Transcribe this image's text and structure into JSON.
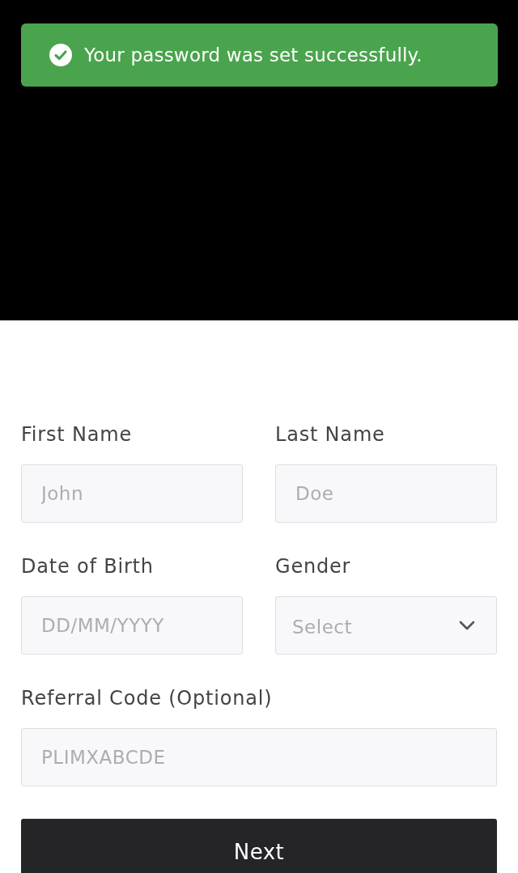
{
  "toast": {
    "message": "Your password was set successfully."
  },
  "form": {
    "rows": [
      {
        "fields": [
          {
            "label": "First Name",
            "kind": "text",
            "placeholder": "John"
          },
          {
            "label": "Last Name",
            "kind": "text",
            "placeholder": "Doe"
          }
        ]
      },
      {
        "fields": [
          {
            "label": "Date of Birth",
            "kind": "text",
            "placeholder": "DD/MM/YYYY"
          },
          {
            "label": "Gender",
            "kind": "select",
            "placeholder": "Select"
          }
        ]
      },
      {
        "fields": [
          {
            "label": "Referral Code (Optional)",
            "kind": "text",
            "placeholder": "PLIMXABCDE"
          }
        ]
      }
    ]
  },
  "button": {
    "label": "Next"
  }
}
